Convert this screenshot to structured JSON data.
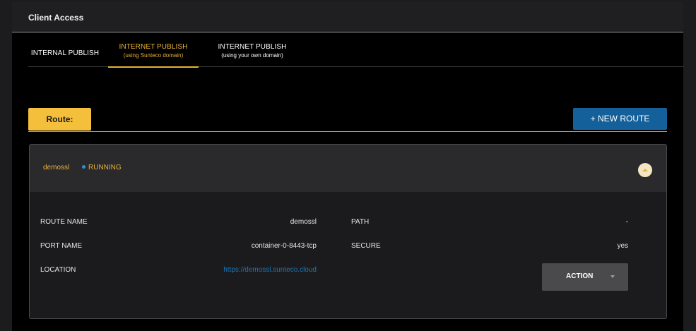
{
  "panel": {
    "title": "Client Access"
  },
  "tabs": [
    {
      "line1": "INTERNAL PUBLISH",
      "line2": ""
    },
    {
      "line1": "INTERNET PUBLISH",
      "line2": "(using Sunteco domain)"
    },
    {
      "line1": "INTERNET PUBLISH",
      "line2": "(using your own domain)"
    }
  ],
  "active_tab": 1,
  "route_label": "Route:",
  "new_route_button": "+ NEW ROUTE",
  "route": {
    "name": "demossl",
    "status": "RUNNING",
    "details": {
      "route_name_label": "ROUTE NAME",
      "route_name_value": "demossl",
      "port_name_label": "PORT NAME",
      "port_name_value": "container-0-8443-tcp",
      "location_label": "LOCATION",
      "location_value": "https://demossl.sunteco.cloud",
      "path_label": "PATH",
      "path_value": "-",
      "secure_label": "SECURE",
      "secure_value": "yes"
    },
    "action_button": "ACTION"
  },
  "colors": {
    "accent": "#e9b233",
    "primary": "#14609a",
    "status_dot": "#2f8fd6",
    "link": "#1f76b5"
  }
}
